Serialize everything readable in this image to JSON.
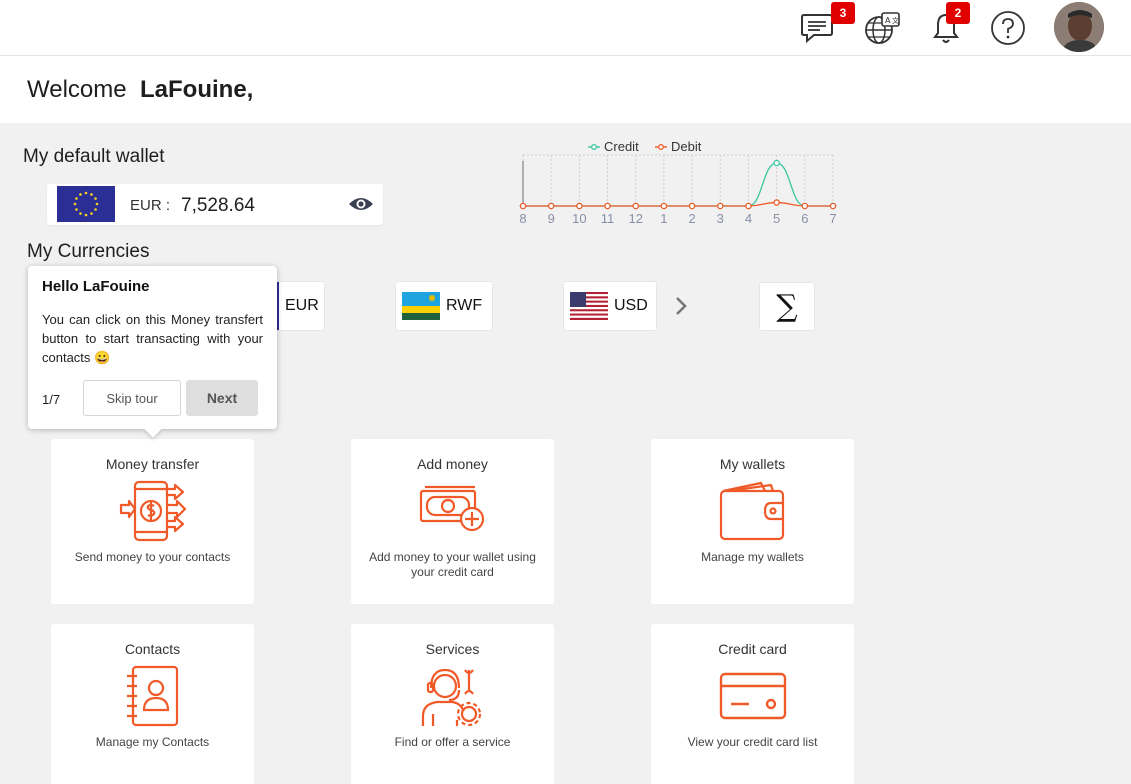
{
  "header": {
    "messages_badge": "3",
    "notifications_badge": "2"
  },
  "welcome": {
    "greeting": "Welcome",
    "user_name": "LaFouine,"
  },
  "wallet": {
    "section_title": "My default wallet",
    "currency_label": "EUR :",
    "amount": "7,528.64"
  },
  "chart_data": {
    "type": "line",
    "x": [
      "8",
      "9",
      "10",
      "11",
      "12",
      "1",
      "2",
      "3",
      "4",
      "5",
      "6",
      "7"
    ],
    "series": [
      {
        "name": "Credit",
        "color": "#3cc6a0",
        "values": [
          0,
          0,
          0,
          0,
          0,
          0,
          0,
          0,
          0,
          1,
          0,
          0
        ]
      },
      {
        "name": "Debit",
        "color": "#f05a28",
        "values": [
          0,
          0,
          0,
          0,
          0,
          0,
          0,
          0,
          0,
          0.08,
          0,
          0
        ]
      }
    ],
    "legend_position": "top",
    "grid": true
  },
  "currencies": {
    "section_title": "My Currencies",
    "items": [
      {
        "code": "EUR"
      },
      {
        "code": "RWF"
      },
      {
        "code": "USD"
      }
    ],
    "sigma_symbol": "∑"
  },
  "tour": {
    "title": "Hello LaFouine",
    "text": "You can click on this Money transfert button to start transacting with your contacts 😀",
    "step": "1/7",
    "skip_label": "Skip tour",
    "next_label": "Next"
  },
  "tiles": [
    {
      "title": "Money transfer",
      "desc": "Send money to your contacts"
    },
    {
      "title": "Add money",
      "desc": "Add money to your wallet using your credit card"
    },
    {
      "title": "My wallets",
      "desc": "Manage my wallets"
    },
    {
      "title": "Contacts",
      "desc": "Manage my Contacts"
    },
    {
      "title": "Services",
      "desc": "Find or offer a service"
    },
    {
      "title": "Credit card",
      "desc": "View your credit card list"
    }
  ],
  "colors": {
    "accent": "#f05a28",
    "credit": "#3cc6a0",
    "badge": "#e00000"
  }
}
